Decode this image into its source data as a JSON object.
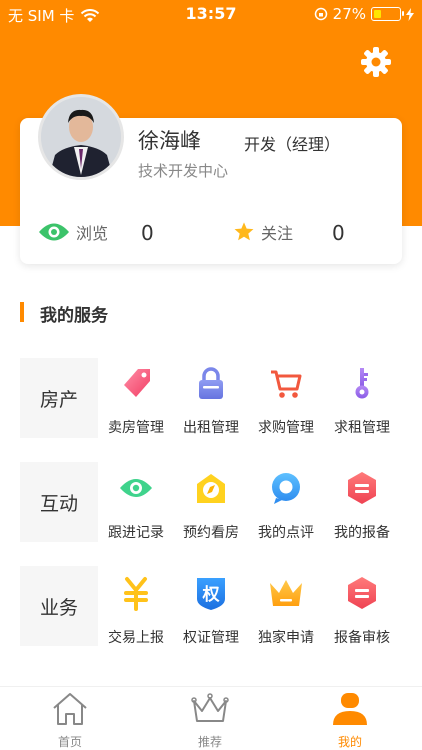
{
  "status_bar": {
    "carrier": "无 SIM 卡",
    "time": "13:57",
    "battery": "27%"
  },
  "profile": {
    "name": "徐海峰",
    "role": "开发（经理）",
    "department": "技术开发中心",
    "stats": [
      {
        "label": "浏览",
        "value": "0"
      },
      {
        "label": "关注",
        "value": "0"
      }
    ]
  },
  "section": {
    "title": "我的服务"
  },
  "categories": [
    {
      "label": "房产",
      "items": [
        {
          "label": "卖房管理",
          "icon": "tag-icon"
        },
        {
          "label": "出租管理",
          "icon": "lock-icon"
        },
        {
          "label": "求购管理",
          "icon": "cart-icon"
        },
        {
          "label": "求租管理",
          "icon": "key-icon"
        }
      ]
    },
    {
      "label": "互动",
      "items": [
        {
          "label": "跟进记录",
          "icon": "eye-icon"
        },
        {
          "label": "预约看房",
          "icon": "compass-icon"
        },
        {
          "label": "我的点评",
          "icon": "comment-icon"
        },
        {
          "label": "我的报备",
          "icon": "report-icon"
        }
      ]
    },
    {
      "label": "业务",
      "items": [
        {
          "label": "交易上报",
          "icon": "yen-icon"
        },
        {
          "label": "权证管理",
          "icon": "certificate-icon"
        },
        {
          "label": "独家申请",
          "icon": "crown-icon"
        },
        {
          "label": "报备审核",
          "icon": "review-icon"
        }
      ]
    }
  ],
  "tabs": [
    {
      "label": "首页",
      "icon": "home-icon",
      "active": false
    },
    {
      "label": "推荐",
      "icon": "crown-outline-icon",
      "active": false
    },
    {
      "label": "我的",
      "icon": "user-icon",
      "active": true
    }
  ],
  "colors": {
    "accent": "#ff8a00",
    "text": "#333333",
    "muted": "#888888"
  }
}
